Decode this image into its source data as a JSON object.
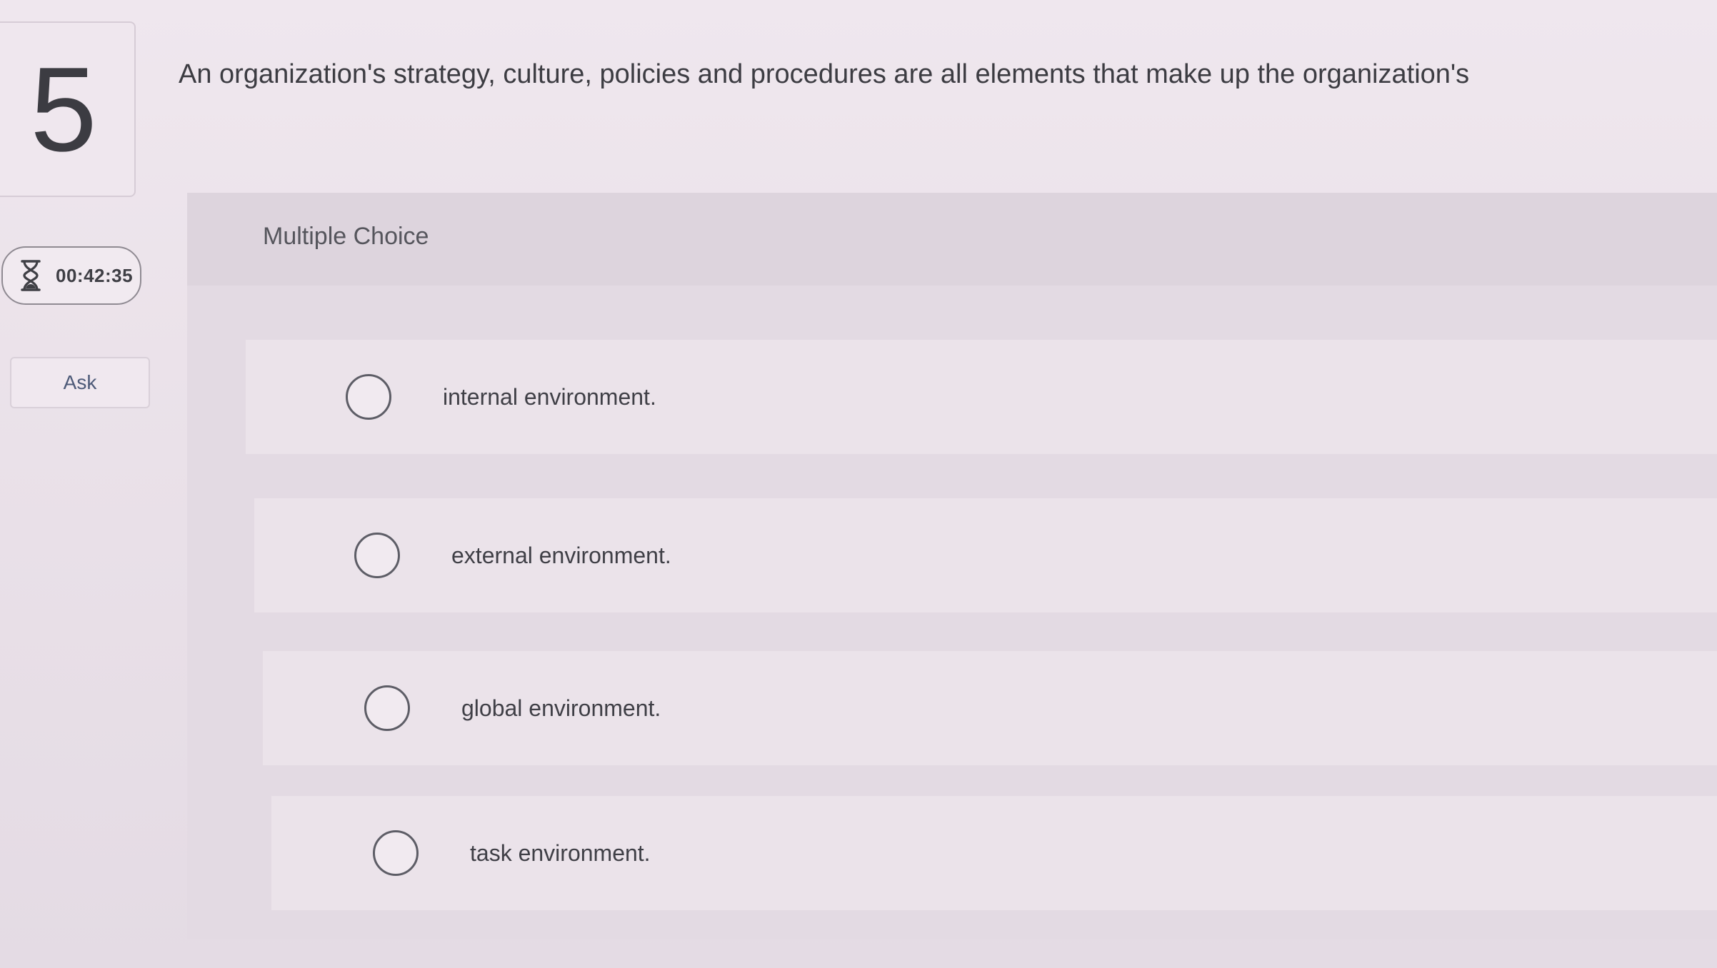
{
  "question": {
    "number": "5",
    "text": "An organization's strategy, culture, policies and procedures are all elements that make up the organization's"
  },
  "timer": {
    "icon": "hourglass-icon",
    "value": "00:42:35"
  },
  "ask_button": {
    "label": "Ask"
  },
  "answer_panel": {
    "type_label": "Multiple Choice",
    "choices": [
      {
        "label": "internal environment."
      },
      {
        "label": "external environment."
      },
      {
        "label": "global environment."
      },
      {
        "label": "task environment."
      }
    ]
  }
}
